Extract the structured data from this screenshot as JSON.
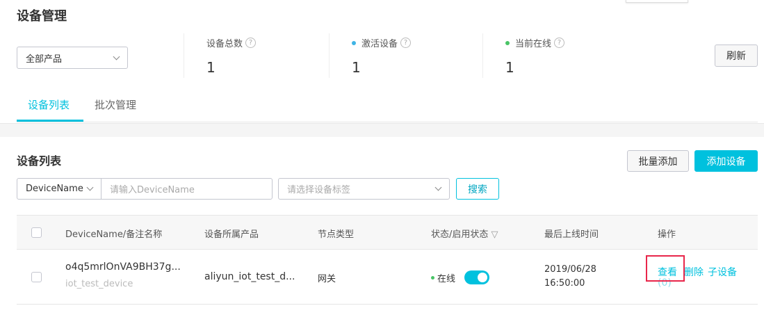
{
  "header": {
    "title": "设备管理",
    "product_select": "全部产品",
    "refresh_label": "刷新"
  },
  "stats": [
    {
      "label": "设备总数",
      "value": "1",
      "help": "?"
    },
    {
      "label": "激活设备",
      "value": "1",
      "help": "?",
      "dot_color": "#3fb4e5"
    },
    {
      "label": "当前在线",
      "value": "1",
      "help": "?",
      "dot_color": "#49c466"
    }
  ],
  "tabs": [
    {
      "label": "设备列表",
      "active": true
    },
    {
      "label": "批次管理",
      "active": false
    }
  ],
  "list": {
    "title": "设备列表",
    "batch_add_label": "批量添加",
    "add_device_label": "添加设备",
    "search_field": "DeviceName",
    "search_placeholder": "请输入DeviceName",
    "tag_placeholder": "请选择设备标签",
    "search_label": "搜索",
    "columns": [
      "DeviceName/备注名称",
      "设备所属产品",
      "节点类型",
      "状态/启用状态",
      "最后上线时间",
      "操作"
    ],
    "rows": [
      {
        "device_name": "o4q5mrlOnVA9BH37g...",
        "remark": "iot_test_device",
        "product": "aliyun_iot_test_d...",
        "node_type": "网关",
        "status": "在线",
        "enabled": true,
        "last_online_date": "2019/06/28",
        "last_online_time": "16:50:00",
        "actions": {
          "view": "查看",
          "delete": "删除",
          "sub": "子设备",
          "sub_count": "(0)"
        }
      }
    ]
  },
  "colors": {
    "accent": "#00c1de",
    "highlight": "#e8264a"
  }
}
